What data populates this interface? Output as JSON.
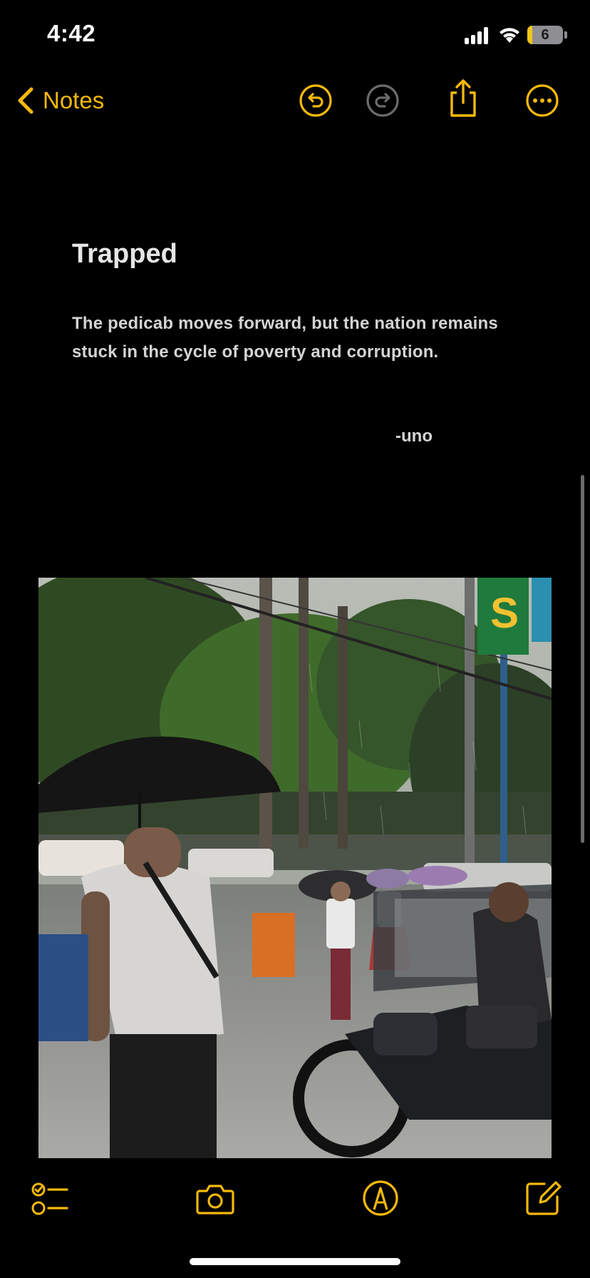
{
  "status_bar": {
    "time": "4:42",
    "battery_level": "6",
    "battery_fraction": 0.06,
    "icons": [
      "cellular-signal-icon",
      "wifi-icon",
      "battery-icon"
    ]
  },
  "nav": {
    "back_label": "Notes",
    "icons": [
      "chevron-left-icon",
      "undo-icon",
      "redo-icon",
      "share-icon",
      "more-icon"
    ],
    "redo_enabled": false
  },
  "note": {
    "title": "Trapped",
    "body": "The pedicab moves forward, but the nation remains stuck in the cycle of poverty and corruption.",
    "signature": "-uno",
    "photo_icon": "street-rain-photo"
  },
  "toolbar": {
    "icons": [
      "checklist-icon",
      "camera-icon",
      "markup-icon",
      "compose-icon"
    ]
  },
  "colors": {
    "accent": "#f5b90c",
    "background": "#000000",
    "text": "#d4d4d4",
    "disabled": "#6b6b6b"
  }
}
